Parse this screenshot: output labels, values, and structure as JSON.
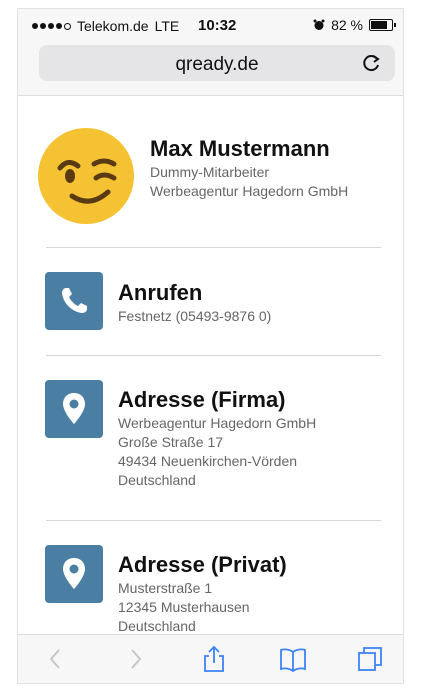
{
  "status_bar": {
    "carrier": "Telekom.de",
    "network": "LTE",
    "time": "10:32",
    "battery": "82 %",
    "battery_level": 0.82
  },
  "browser": {
    "url": "qready.de"
  },
  "contact": {
    "name": "Max Mustermann",
    "title": "Dummy-Mitarbeiter",
    "company": "Werbeagentur Hagedorn GmbH"
  },
  "actions": [
    {
      "title": "Anrufen",
      "lines": [
        "Festnetz (05493-9876 0)"
      ]
    },
    {
      "title": "Adresse (Firma)",
      "lines": [
        "Werbeagentur Hagedorn GmbH",
        "Große Straße 17",
        "49434 Neuenkirchen-Vörden",
        "Deutschland"
      ]
    },
    {
      "title": "Adresse (Privat)",
      "lines": [
        "Musterstraße 1",
        "12345 Musterhausen",
        "Deutschland"
      ]
    }
  ],
  "colors": {
    "tile": "#4a7fa3",
    "ios_blue": "#3b82f6"
  },
  "icons": {
    "avatar": "winking-face-emoji",
    "call": "phone-icon",
    "address": "map-pin-icon"
  }
}
